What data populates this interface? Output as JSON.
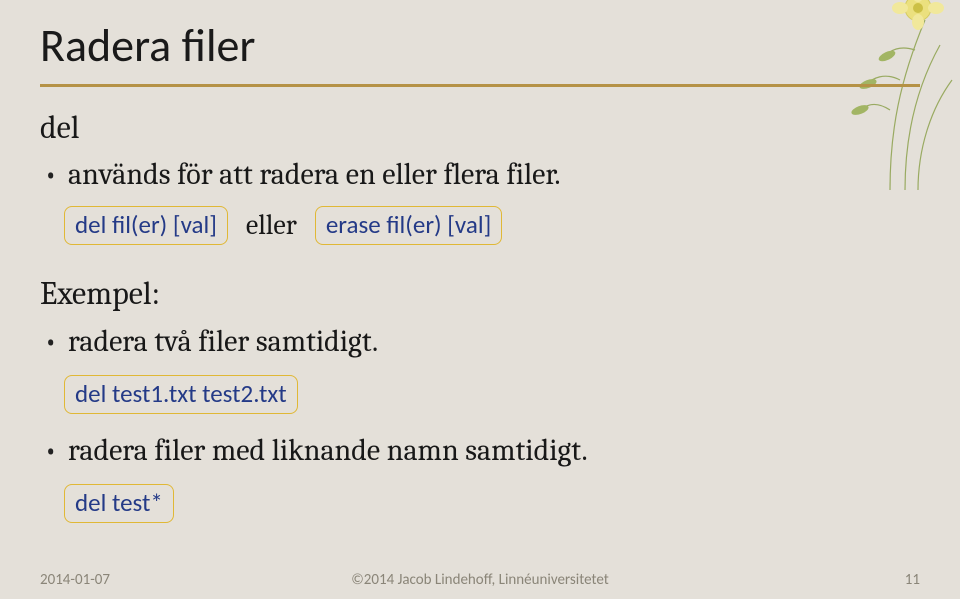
{
  "title": "Radera filer",
  "sections": {
    "command_name": "del",
    "bullet1": "används för att radera en eller flera filer.",
    "cmd1": "del fil(er) [val]",
    "interstitial": "eller",
    "cmd2": "erase fil(er) [val]",
    "example_heading": "Exempel:",
    "bullet2": "radera två filer samtidigt.",
    "cmd3": "del test1.txt test2.txt",
    "bullet3": "radera filer med liknande namn samtidigt.",
    "cmd4": "del test*"
  },
  "footer": {
    "date": "2014-01-07",
    "copyright": "©2014 Jacob Lindehoff, Linnéuniversitetet",
    "page": "11"
  },
  "colors": {
    "accent": "#b59246",
    "box_border": "#e0b836",
    "cmd_text": "#243a87"
  }
}
